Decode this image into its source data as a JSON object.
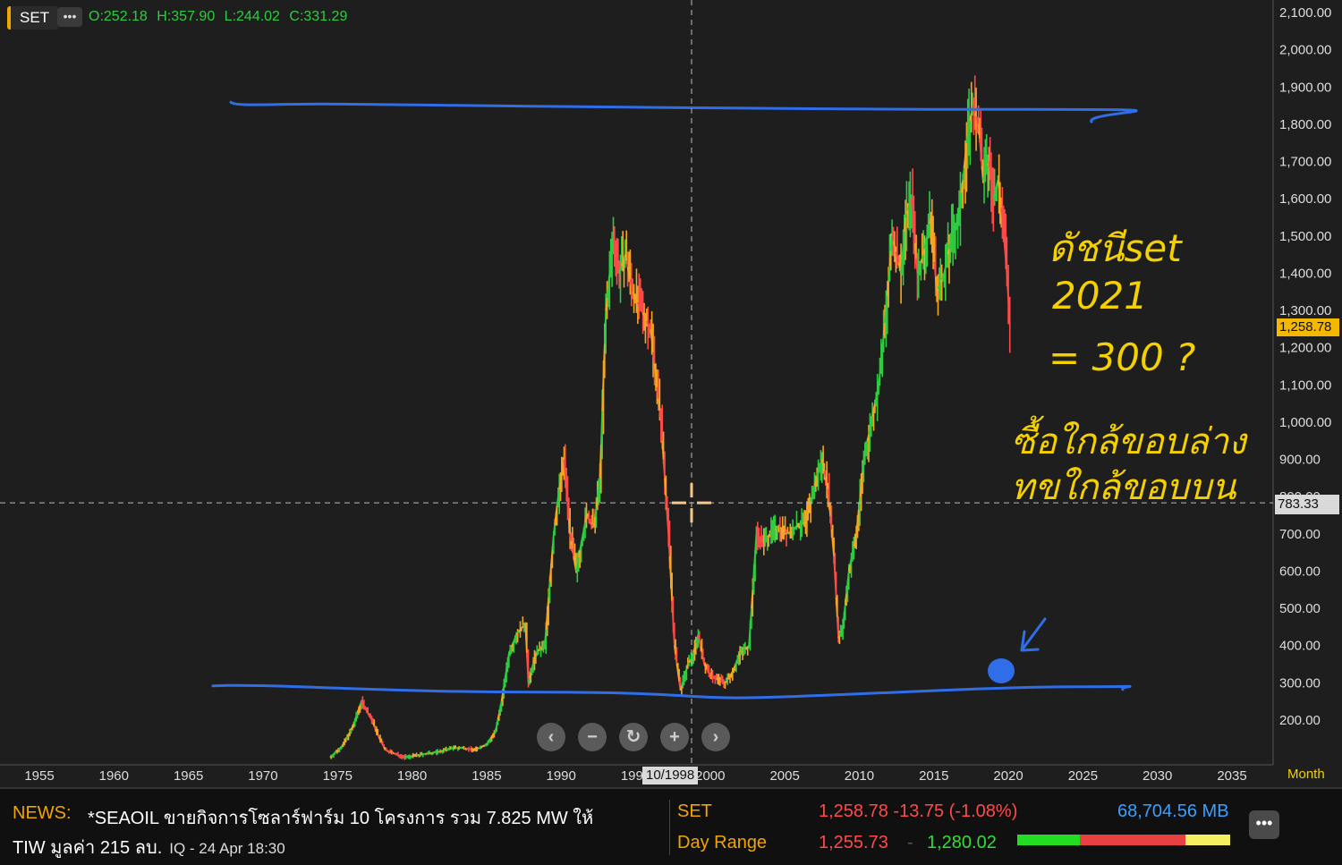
{
  "header": {
    "symbol": "SET",
    "more_icon": "•••",
    "open": "O:252.18",
    "high": "H:357.90",
    "low": "L:244.02",
    "close": "C:331.29"
  },
  "chart_data": {
    "type": "candlestick-line",
    "symbol": "SET",
    "interval_label": "Month",
    "y_ticks": [
      "2,100.00",
      "2,000.00",
      "1,900.00",
      "1,800.00",
      "1,700.00",
      "1,600.00",
      "1,500.00",
      "1,400.00",
      "1,300.00",
      "1,200.00",
      "1,100.00",
      "1,000.00",
      "900.00",
      "800.00",
      "700.00",
      "600.00",
      "500.00",
      "400.00",
      "300.00",
      "200.00"
    ],
    "y_tick_values": [
      2100,
      2000,
      1900,
      1800,
      1700,
      1600,
      1500,
      1400,
      1300,
      1200,
      1100,
      1000,
      900,
      800,
      700,
      600,
      500,
      400,
      300,
      200
    ],
    "x_ticks": [
      "1955",
      "1960",
      "1965",
      "1970",
      "1975",
      "1980",
      "1985",
      "1990",
      "1995",
      "2000",
      "2005",
      "2010",
      "2015",
      "2020",
      "2025",
      "2030",
      "2035"
    ],
    "x_tick_values": [
      1955,
      1960,
      1965,
      1970,
      1975,
      1980,
      1985,
      1990,
      1995,
      2000,
      2005,
      2010,
      2015,
      2020,
      2025,
      2030,
      2035
    ],
    "last_price_tag": "1,258.78",
    "crosshair_price": "783.33",
    "crosshair_date": "10/1998",
    "crosshair_x": 1998.75,
    "crosshair_y": 783.33,
    "series": [
      {
        "x": [
          1974.5,
          1975.3,
          1976.0,
          1976.6,
          1977.3,
          1977.7,
          1978.2,
          1978.8,
          1979.5,
          1980.3,
          1981.0,
          1981.8,
          1982.6,
          1983.4,
          1984.2,
          1985.0,
          1985.6,
          1986.0,
          1986.5,
          1987.0,
          1987.6,
          1987.8,
          1988.3,
          1988.9,
          1989.5,
          1989.8,
          1990.2,
          1990.6,
          1991.0,
          1991.7,
          1992.2,
          1992.6,
          1993.0,
          1993.5,
          1993.9,
          1994.3,
          1994.8,
          1995.4,
          1996.0,
          1996.7,
          1997.2,
          1997.6,
          1998.0,
          1998.5,
          1998.8,
          1999.2,
          1999.6,
          2000.0,
          2000.5,
          2001.0,
          2001.5,
          2002.0,
          2002.6,
          2003.1,
          2003.6,
          2004.0,
          2004.6,
          2005.2,
          2005.8,
          2006.4,
          2007.0,
          2007.5,
          2007.9,
          2008.3,
          2008.6,
          2008.9,
          2009.3,
          2009.8,
          2010.3,
          2010.8,
          2011.3,
          2011.8,
          2012.2,
          2012.8,
          2013.1,
          2013.5,
          2013.9,
          2014.3,
          2014.8,
          2015.2,
          2015.7,
          2016.2,
          2016.7,
          2017.2,
          2017.6,
          2018.0,
          2018.3,
          2018.7,
          2019.0,
          2019.3,
          2019.6,
          2019.9,
          2020.1
        ],
        "y": [
          100,
          130,
          180,
          250,
          200,
          160,
          120,
          110,
          100,
          105,
          110,
          115,
          125,
          125,
          120,
          135,
          170,
          250,
          380,
          430,
          460,
          300,
          380,
          400,
          700,
          800,
          900,
          700,
          600,
          750,
          720,
          850,
          1300,
          1500,
          1400,
          1450,
          1350,
          1300,
          1250,
          1000,
          700,
          400,
          280,
          350,
          370,
          430,
          350,
          320,
          310,
          300,
          330,
          380,
          400,
          700,
          680,
          700,
          720,
          700,
          720,
          730,
          830,
          900,
          820,
          640,
          420,
          450,
          600,
          700,
          900,
          1000,
          1100,
          1300,
          1500,
          1400,
          1550,
          1600,
          1400,
          1450,
          1550,
          1350,
          1400,
          1500,
          1550,
          1750,
          1850,
          1800,
          1650,
          1700,
          1600,
          1650,
          1550,
          1400,
          1258.78
        ]
      }
    ]
  },
  "annotations": {
    "handwriting_line1": "ดัชนีset",
    "handwriting_line2": "2021",
    "handwriting_line3": "= 300 ?",
    "handwriting_line4": "ซื้อใกล้ขอบล่าง",
    "handwriting_line5": "ทขใกล้ขอบบน",
    "upper_channel_price": 1840,
    "lower_channel_price": 275,
    "pen_color": "#2f6ee8",
    "text_color": "#f5d000"
  },
  "controls": {
    "prev_icon": "‹",
    "zoom_out_icon": "−",
    "reset_icon": "↻",
    "zoom_in_icon": "+",
    "next_icon": "›"
  },
  "colors": {
    "up": "#2ecc40",
    "down": "#ff4a4a",
    "mid": "#f5a623",
    "last_tag": "#f5b800"
  },
  "footer": {
    "news_label": "NEWS:",
    "news_line1": "*SEAOIL ขายกิจการโซลาร์ฟาร์ม 10 โครงการ รวม 7.825 MW ให้",
    "news_line2": "TIW มูลค่า 215 ลบ.",
    "news_source": "IQ - 24 Apr 18:30",
    "quote_symbol": "SET",
    "quote_price_change": "1,258.78 -13.75 (-1.08%)",
    "quote_value": "68,704.56 MB",
    "day_range_label": "Day Range",
    "day_range_low": "1,255.73",
    "day_range_sep": "-",
    "day_range_high": "1,280.02",
    "menu_icon": "•••"
  }
}
